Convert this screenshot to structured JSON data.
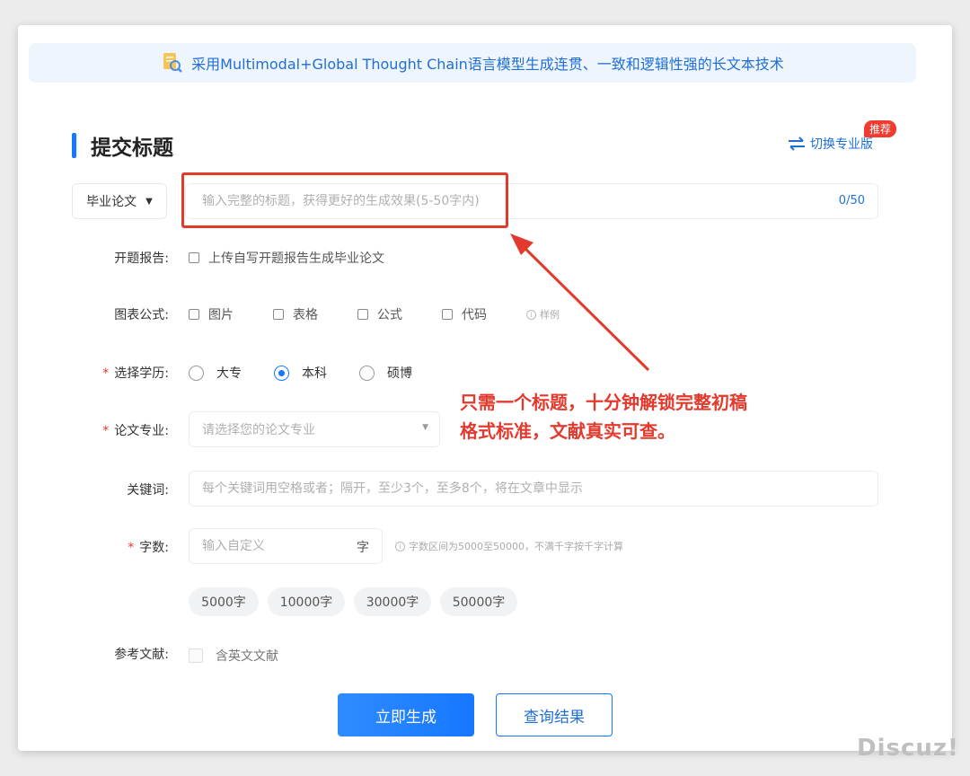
{
  "banner": {
    "icon": "document-magnifier-icon",
    "text": "采用Multimodal+Global Thought Chain语言模型生成连贯、一致和逻辑性强的长文本技术"
  },
  "header": {
    "title": "提交标题",
    "switch_label": "切换专业版",
    "switch_icon": "swap-arrows-icon",
    "badge": "推荐"
  },
  "title_row": {
    "type_selected": "毕业论文",
    "title_placeholder": "输入完整的标题，获得更好的生成效果(5-50字内)",
    "counter": "0/50"
  },
  "proposal": {
    "label": "开题报告:",
    "checkbox_label": "上传自写开题报告生成毕业论文"
  },
  "figures": {
    "label": "图表公式:",
    "options": [
      "图片",
      "表格",
      "公式",
      "代码"
    ],
    "hint": "样例"
  },
  "degree": {
    "label": "选择学历:",
    "required_mark": "*",
    "options": [
      "大专",
      "本科",
      "硕博"
    ],
    "selected": "本科"
  },
  "major": {
    "label": "论文专业:",
    "required_mark": "*",
    "placeholder": "请选择您的论文专业"
  },
  "keywords": {
    "label": "关键词:",
    "placeholder": "每个关键词用空格或者；隔开，至少3个，至多8个，将在文章中显示"
  },
  "word_count": {
    "label": "字数:",
    "required_mark": "*",
    "placeholder": "输入自定义",
    "unit": "字",
    "hint": "字数区间为5000至50000，不满千字按千字计算",
    "presets": [
      "5000字",
      "10000字",
      "30000字",
      "50000字"
    ]
  },
  "references": {
    "label": "参考文献:",
    "checkbox_label": "含英文文献"
  },
  "actions": {
    "generate": "立即生成",
    "query": "查询结果"
  },
  "annotation": {
    "line1": "只需一个标题，十分钟解锁完整初稿",
    "line2": "格式标准，文献真实可查。"
  },
  "watermark": "Discuz!",
  "colors": {
    "accent": "#1677ff",
    "annotation_red": "#e33a2e",
    "banner_bg": "#eef5fd"
  }
}
